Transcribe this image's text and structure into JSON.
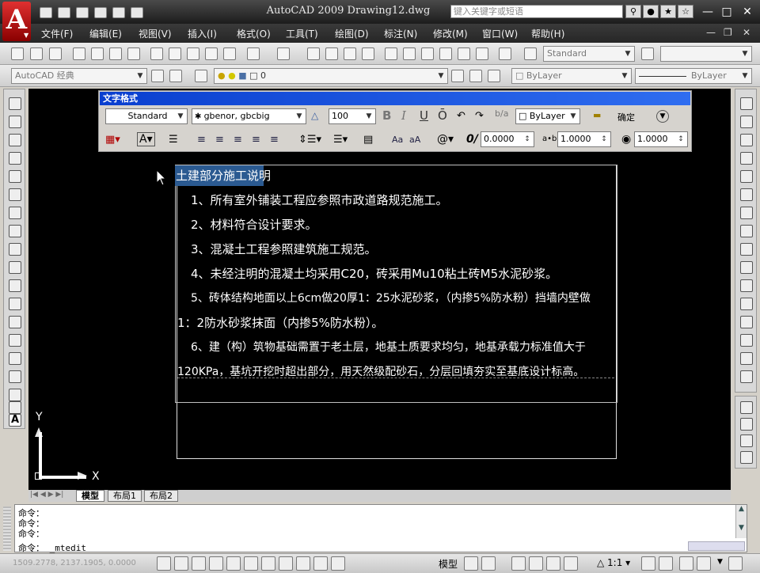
{
  "window": {
    "title": "AutoCAD 2009  Drawing12.dwg",
    "search_placeholder": "键入关键字或短语"
  },
  "menu": [
    "文件(F)",
    "编辑(E)",
    "视图(V)",
    "插入(I)",
    "格式(O)",
    "工具(T)",
    "绘图(D)",
    "标注(N)",
    "修改(M)",
    "窗口(W)",
    "帮助(H)"
  ],
  "toolbar": {
    "text_style": "Standard",
    "workspace": "AutoCAD 经典",
    "layer": "0",
    "color": "ByLayer",
    "linetype": "ByLayer"
  },
  "text_format": {
    "title": "文字格式",
    "style": "Standard",
    "font": "gbenor, gbcbig",
    "height": "100",
    "bold": "B",
    "italic": "I",
    "underline": "U",
    "overline": "Ō",
    "color": "ByLayer",
    "ok_label": "确定",
    "oblique_prefix": "0/",
    "oblique": "0.0000",
    "tracking_prefix": "a•b",
    "tracking": "1.0000",
    "width_factor": "1.0000",
    "case_upper": "Aa",
    "case_lower": "aA",
    "symbol": "@"
  },
  "mtext": {
    "heading": "土建部分施工说明",
    "lines": [
      "1、所有室外铺装工程应参照市政道路规范施工。",
      "2、材料符合设计要求。",
      "3、混凝土工程参照建筑施工规范。",
      "4、未经注明的混凝土均采用C20，砖采用Mu10粘土砖M5水泥砂浆。",
      "5、砖体结构地面以上6cm做20厚1：25水泥砂浆，（内掺5%防水粉）挡墙内壁做",
      "1：2防水砂浆抹面（内掺5%防水粉）。",
      "6、建（构）筑物基础需置于老土层，地基土质要求均匀，地基承载力标准值大于",
      "120KPa，基坑开挖时超出部分，用天然级配砂石，分层回填夯实至基底设计标高。"
    ]
  },
  "ucs": {
    "x_label": "X",
    "y_label": "Y"
  },
  "tabs": [
    "模型",
    "布局1",
    "布局2"
  ],
  "command": {
    "history": [
      "命令：",
      "命令：",
      "命令："
    ],
    "current": "命令：  _mtedit"
  },
  "status": {
    "coordinates": "1509.2778, 2137.1905, 0.0000",
    "model_label": "模型",
    "scale": "1:1"
  }
}
